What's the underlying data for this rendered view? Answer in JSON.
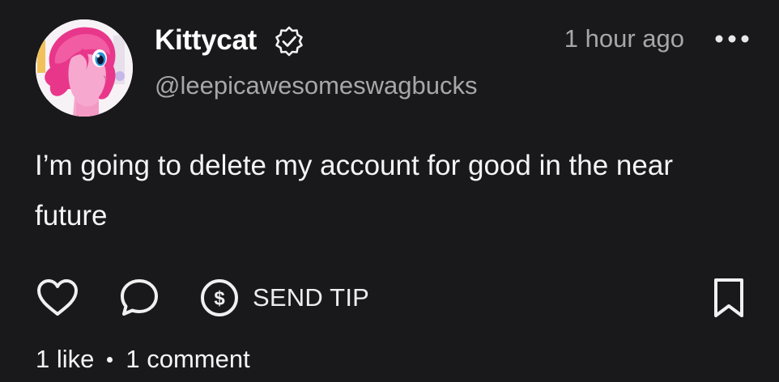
{
  "post": {
    "author": {
      "display_name": "Kittycat",
      "handle": "@leepicawesomeswagbucks",
      "verified": true,
      "avatar": "pink-pony-avatar"
    },
    "timestamp": "1 hour ago",
    "body": "I’m going to delete my account for good in the near future",
    "actions": {
      "like_icon": "heart-icon",
      "comment_icon": "speech-bubble-icon",
      "tip_icon": "dollar-coin-icon",
      "tip_label": "SEND TIP",
      "bookmark_icon": "bookmark-icon",
      "more_icon": "more-dots-icon"
    },
    "stats": {
      "likes": "1 like",
      "comments": "1 comment"
    }
  },
  "colors": {
    "background": "#19181b",
    "text": "#f4f4f4",
    "muted": "#a7a7ab",
    "avatar_pink": "#f0609e"
  }
}
